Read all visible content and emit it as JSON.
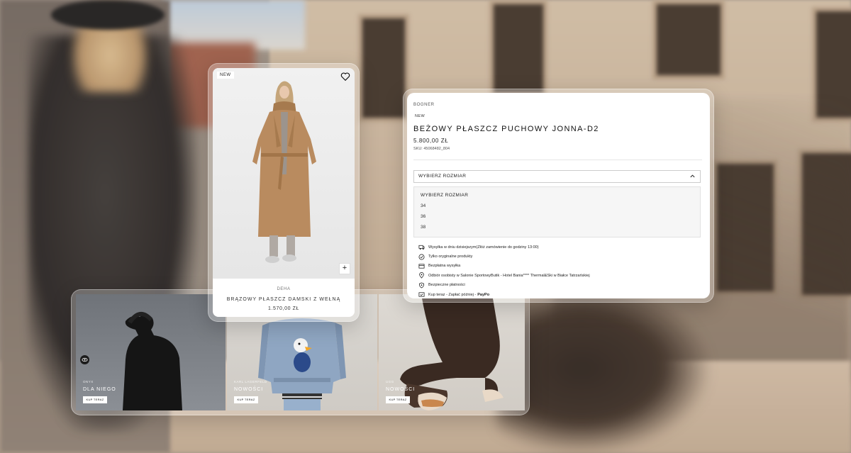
{
  "product_card": {
    "badge": "NEW",
    "brand": "DEHA",
    "name": "BRĄZOWY PŁASZCZ DAMSKI Z WEŁNĄ",
    "price": "1.570,00 ZŁ",
    "plus": "+"
  },
  "detail": {
    "brand": "BOGNER",
    "badge": "NEW",
    "title": "BEŻOWY PŁASZCZ PUCHOWY JONNA-D2",
    "price": "5.800,00 ZŁ",
    "sku": "SKU: 45068482_804",
    "size_select": "WYBIERZ ROZMIAR",
    "size_options": [
      "WYBIERZ ROZMIAR",
      "34",
      "36",
      "38"
    ],
    "benefits": [
      {
        "icon": "delivery-icon",
        "text": "Wysyłka w dniu dzisiejszym(Złóż zamówienie do godziny 13:00)"
      },
      {
        "icon": "check-badge-icon",
        "text": "Tylko oryginalne produkty"
      },
      {
        "icon": "truck-icon",
        "text": "Bezpłatna wysyłka"
      },
      {
        "icon": "location-pin-icon",
        "text": "Odbiór osobisty w Salonie SportowyButik - Hotel Bania**** Thermal&Ski w Białce Tatrzańskiej"
      },
      {
        "icon": "shield-icon",
        "text": "Bezpieczne płatności"
      },
      {
        "icon": "wallet-icon",
        "text": "Kup teraz - Zapłać później - ",
        "brand": "PayPo"
      }
    ]
  },
  "categories": [
    {
      "label": "ONYX",
      "title": "DLA NIEGO",
      "button": "KUP TERAZ"
    },
    {
      "label": "KARL LAGERFELD",
      "title": "NOWOŚCI",
      "button": "KUP TERAZ"
    },
    {
      "label": "UGG",
      "title": "NOWOŚCI",
      "button": "KUP TERAZ"
    }
  ],
  "colors": {
    "accent": "#111111",
    "coat": "#b98b5f"
  }
}
